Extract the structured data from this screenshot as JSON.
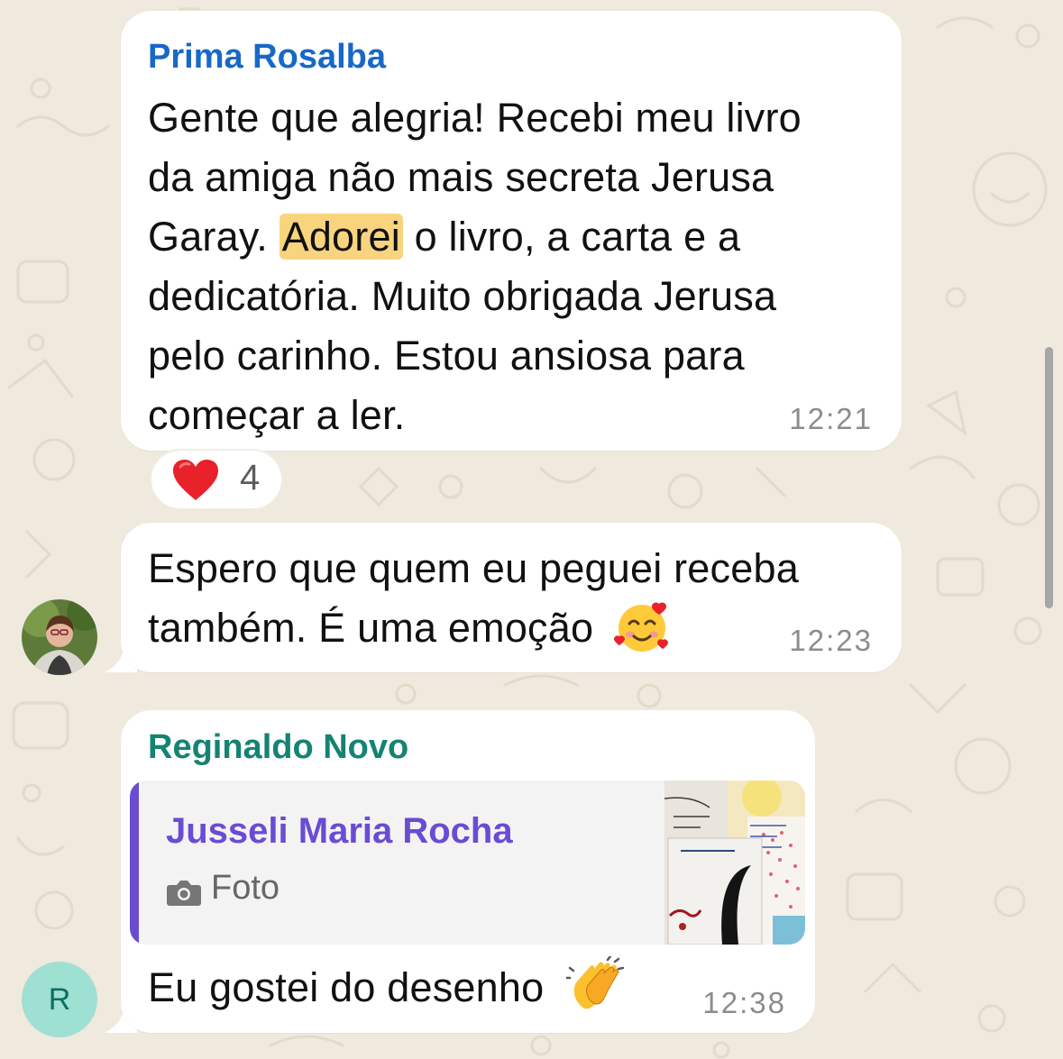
{
  "colors": {
    "wallpaper": "#EFE9DE",
    "bubble": "#FFFFFF",
    "sender_prima": "#1868C8",
    "sender_reginaldo": "#158373",
    "quote_author": "#6A4CD3",
    "quote_bar": "#6A4CD3",
    "highlight": "#F9D47E",
    "time": "#8C8C8C",
    "avatar_letter_bg": "#9EE0D2"
  },
  "messages": [
    {
      "sender": "Prima Rosalba",
      "lines": [
        "Gente que alegria! Recebi meu livro",
        "da amiga não mais secreta Jerusa",
        "Garay.",
        "Adorei",
        "o livro, a carta e a",
        "dedicatória. Muito obrigada Jerusa",
        "pelo carinho. Estou ansiosa para",
        "começar a ler."
      ],
      "time": "12:21",
      "reaction": {
        "emoji_icon": "red-heart-icon",
        "count": "4"
      }
    },
    {
      "lines": [
        "Espero que quem eu peguei receba",
        "também. É uma emoção"
      ],
      "emoji_icon": "smiling-face-with-hearts-icon",
      "time": "12:23",
      "avatar_icon": "user-photo-avatar"
    },
    {
      "sender": "Reginaldo Novo",
      "quote": {
        "author": "Jusseli Maria Rocha",
        "type_icon": "camera-icon",
        "type_label": "Foto",
        "thumbnail_icon": "book-photo-thumbnail"
      },
      "text": "Eu gostei do desenho",
      "emoji_icon": "clapping-hands-icon",
      "time": "12:38",
      "avatar_letter": "R"
    }
  ]
}
